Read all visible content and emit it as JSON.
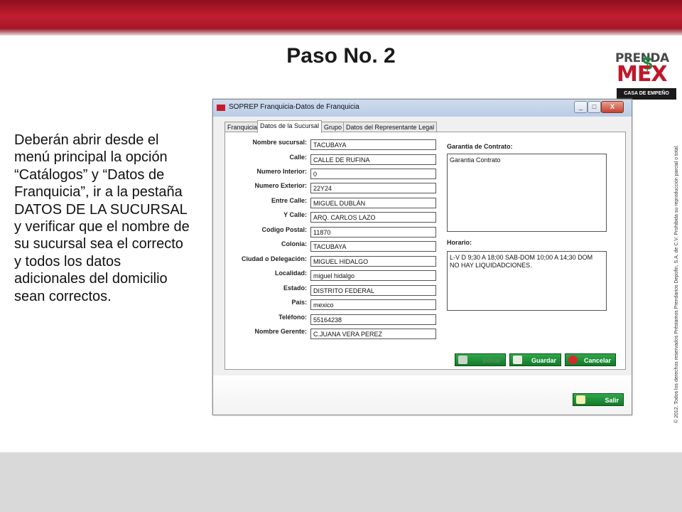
{
  "slide": {
    "title": "Paso No. 2",
    "body": "Deberán abrir desde el menú principal la opción “Catálogos” y “Datos de Franquicia”, ir a la pestaña DATOS DE LA SUCURSAL y verificar que el nombre de su sucursal sea el correcto y todos los datos adicionales del domicilio sean correctos.",
    "copyright": "© 2012. Todos los derechos reservados Préstamos Prendarios Depofin, S.A. de C.V. Prohibida su reproducción parcial o total.",
    "logo": {
      "line1": "PRENDA",
      "line2": "MEX",
      "tagline": "CASA DE EMPEÑO",
      "symbol": "$"
    },
    "colors": {
      "brand_red": "#c0182a",
      "brand_green": "#1c8a3c"
    }
  },
  "window": {
    "title": "SOPREP Franquicia-Datos de Franquicia",
    "controls": {
      "minimize": "_",
      "maximize": "□",
      "close": "X"
    },
    "tabs": [
      {
        "label": "Franquicia"
      },
      {
        "label": "Datos de la Sucursal",
        "active": true
      },
      {
        "label": "Grupo"
      },
      {
        "label": "Datos del Representante Legal"
      }
    ],
    "fields": [
      {
        "label": "Nombre sucursal:",
        "value": "TACUBAYA"
      },
      {
        "label": "Calle:",
        "value": "CALLE DE RUFINA"
      },
      {
        "label": "Numero Interior:",
        "value": "0"
      },
      {
        "label": "Numero Exterior:",
        "value": "22Y24"
      },
      {
        "label": "Entre Calle:",
        "value": "MIGUEL DUBLÁN"
      },
      {
        "label": "Y Calle:",
        "value": "ARQ. CARLOS LAZO"
      },
      {
        "label": "Codigo Postal:",
        "value": "11870"
      },
      {
        "label": "Colonia:",
        "value": "TACUBAYA"
      },
      {
        "label": "Ciudad o Delegación:",
        "value": "MIGUEL HIDALGO"
      },
      {
        "label": "Localidad:",
        "value": "miguel hidalgo"
      },
      {
        "label": "Estado:",
        "value": "DISTRITO FEDERAL"
      },
      {
        "label": "País:",
        "value": "mexico"
      },
      {
        "label": "Teléfono:",
        "value": "55164238"
      },
      {
        "label": "Nombre Gerente:",
        "value": "C.JUANA VERA PEREZ"
      }
    ],
    "garantia": {
      "label": "Garantia de Contrato:",
      "value": "Garantia Contrato"
    },
    "horario": {
      "label": "Horario:",
      "value": "L-V D 9;30 A 18;00 SAB-DOM 10;00 A 14;30 DOM NO HAY LIQUIDADCIONES."
    },
    "buttons": {
      "editar": "Editar",
      "guardar": "Guardar",
      "cancelar": "Cancelar",
      "salir": "Salir"
    }
  }
}
